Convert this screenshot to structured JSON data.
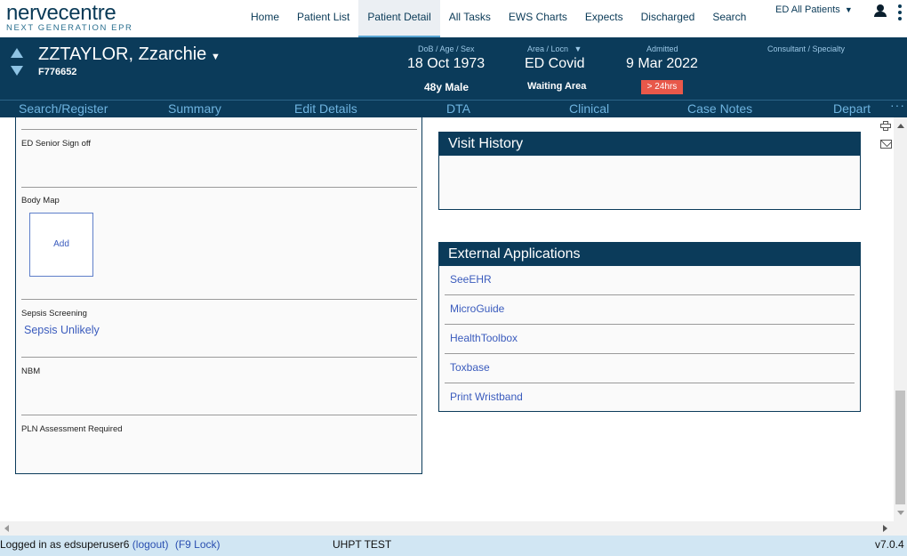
{
  "logo": {
    "main": "nervecentre",
    "sub": "NEXT GENERATION EPR"
  },
  "top_nav": [
    {
      "label": "Home",
      "active": false
    },
    {
      "label": "Patient List",
      "active": false
    },
    {
      "label": "Patient Detail",
      "active": true
    },
    {
      "label": "All Tasks",
      "active": false
    },
    {
      "label": "EWS Charts",
      "active": false
    },
    {
      "label": "Expects",
      "active": false
    },
    {
      "label": "Discharged",
      "active": false
    },
    {
      "label": "Search",
      "active": false
    }
  ],
  "ward_select": {
    "value": "ED All Patients",
    "caret": "▼"
  },
  "icons": {
    "user": "user-icon",
    "menu": "kebab-menu-icon",
    "print": "printer-icon",
    "email": "mail-icon"
  },
  "patient": {
    "name": "ZZTAYLOR, Zzarchie",
    "name_caret": "▼",
    "id": "F776652",
    "dob_label": "DoB / Age / Sex",
    "dob": "18 Oct 1973",
    "age_sex": "48y Male",
    "area_label": "Area / Locn",
    "area_caret": "▼",
    "area": "ED Covid",
    "location": "Waiting Area",
    "admitted_label": "Admitted",
    "admitted": "9 Mar 2022",
    "admitted_badge": "> 24hrs",
    "consultant_label": "Consultant / Specialty"
  },
  "sub_nav": [
    "Search/Register",
    "Summary",
    "Edit Details",
    "DTA",
    "Clinical",
    "Case Notes",
    "Depart"
  ],
  "sub_nav_more": "···",
  "left_panel": {
    "senior_signoff_label": "ED Senior Sign off",
    "body_map_label": "Body Map",
    "body_map_add": "Add",
    "sepsis_label": "Sepsis Screening",
    "sepsis_value": "Sepsis Unlikely",
    "nbm_label": "NBM",
    "pln_label": "PLN Assessment Required"
  },
  "visit_history": {
    "title": "Visit History"
  },
  "external_apps": {
    "title": "External Applications",
    "items": [
      "SeeEHR",
      "MicroGuide",
      "HealthToolbox",
      "Toxbase",
      "Print Wristband"
    ]
  },
  "status_bar": {
    "login_prefix": "Logged in as edsuperuser6",
    "logout": "(logout)",
    "lock": "(F9 Lock)",
    "environment": "UHPT TEST",
    "version": "v7.0.4"
  },
  "colors": {
    "banner": "#0b3b5a",
    "link": "#3a5bbd",
    "badge": "#e8584a",
    "status_bar": "#d1e6f3"
  }
}
